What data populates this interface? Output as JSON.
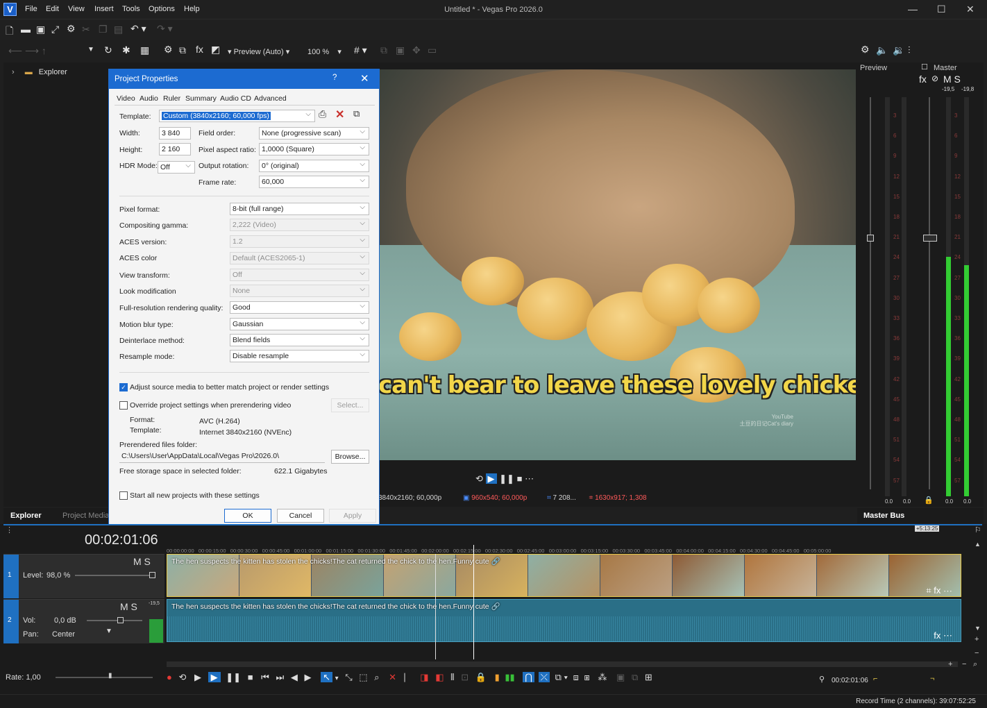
{
  "app": {
    "logo": "V",
    "window_title": "Untitled * - Vegas Pro 2026.0",
    "menu": [
      "File",
      "Edit",
      "View",
      "Insert",
      "Tools",
      "Options",
      "Help"
    ]
  },
  "toolbar2": {
    "preview_quality": "Preview (Auto)",
    "zoom": "100 %"
  },
  "explorer": {
    "tree_item": "Explorer",
    "tabs": [
      "Explorer",
      "Project Media"
    ]
  },
  "preview": {
    "subtitle": "can't bear to leave these lovely chickens.",
    "watermark_line1": "YouTube",
    "watermark_line2": "土豆的日记Cat's diary",
    "status_project": "3840x2160; 60,000p",
    "status_preview": "960x540; 60,000p",
    "status_frame": "7 208...",
    "status_display": "1630x917; 1,308"
  },
  "master": {
    "preview_label": "Preview",
    "master_label": "Master",
    "ms_label": "M S",
    "peak_left": "-19,5",
    "peak_right": "-19,8",
    "scale": [
      "3",
      "6",
      "9",
      "12",
      "15",
      "18",
      "21",
      "24",
      "27",
      "30",
      "33",
      "36",
      "39",
      "42",
      "45",
      "48",
      "51",
      "54",
      "57"
    ],
    "bottom_left": "0.0",
    "bottom_right": "0.0",
    "tab": "Master Bus",
    "meter_levels": [
      0.0,
      0.0,
      0.6,
      0.58
    ]
  },
  "dialog": {
    "title": "Project Properties",
    "help": "?",
    "tabs": [
      "Video",
      "Audio",
      "Ruler",
      "Summary",
      "Audio CD",
      "Advanced"
    ],
    "template_label": "Template:",
    "template_value": "Custom (3840x2160; 60,000 fps)",
    "width_label": "Width:",
    "width_value": "3 840",
    "height_label": "Height:",
    "height_value": "2 160",
    "hdr_label": "HDR Mode:",
    "hdr_value": "Off",
    "field_order_label": "Field order:",
    "field_order_value": "None (progressive scan)",
    "par_label": "Pixel aspect ratio:",
    "par_value": "1,0000 (Square)",
    "rotation_label": "Output rotation:",
    "rotation_value": "0° (original)",
    "framerate_label": "Frame rate:",
    "framerate_value": "60,000",
    "settings": [
      {
        "label": "Pixel format:",
        "value": "8-bit (full range)",
        "disabled": false
      },
      {
        "label": "Compositing gamma:",
        "value": "2,222 (Video)",
        "disabled": true
      },
      {
        "label": "ACES version:",
        "value": "1.2",
        "disabled": true
      },
      {
        "label": "ACES color",
        "value": "Default (ACES2065-1)",
        "disabled": true
      },
      {
        "label": "View transform:",
        "value": "Off",
        "disabled": true
      },
      {
        "label": "Look modification",
        "value": "None",
        "disabled": true
      },
      {
        "label": "Full-resolution rendering quality:",
        "value": "Good",
        "disabled": false
      },
      {
        "label": "Motion blur type:",
        "value": "Gaussian",
        "disabled": false
      },
      {
        "label": "Deinterlace method:",
        "value": "Blend fields",
        "disabled": false
      },
      {
        "label": "Resample mode:",
        "value": "Disable resample",
        "disabled": false
      }
    ],
    "adjust_label": "Adjust source media to better match project or render settings",
    "override_label": "Override project settings when prerendering video",
    "select_button": "Select...",
    "format_label": "Format:",
    "format_value": "AVC (H.264)",
    "pr_template_label": "Template:",
    "pr_template_value": "Internet 3840x2160 (NVEnc)",
    "folder_label": "Prerendered files folder:",
    "folder_value": "C:\\Users\\User\\AppData\\Local\\Vegas Pro\\2026.0\\",
    "browse_button": "Browse...",
    "storage_label": "Free storage space in selected folder:",
    "storage_value": "622.1 Gigabytes",
    "start_all_label": "Start all new projects with these settings",
    "ok": "OK",
    "cancel": "Cancel",
    "apply": "Apply"
  },
  "timeline": {
    "timecode": "00:02:01:06",
    "marker": "+5:13:25",
    "ruler": [
      "00:00:00:00",
      "00:00:15:00",
      "00:00:30:00",
      "00:00:45:00",
      "00:01:00:00",
      "00:01:15:00",
      "00:01:30:00",
      "00:01:45:00",
      "00:02:00:00",
      "00:02:15:00",
      "00:02:30:00",
      "00:02:45:00",
      "00:03:00:00",
      "00:03:15:00",
      "00:03:30:00",
      "00:03:45:00",
      "00:04:00:00",
      "00:04:15:00",
      "00:04:30:00",
      "00:04:45:00",
      "00:05:00:00"
    ],
    "video_track": {
      "number": "1",
      "ms": "M S",
      "level_label": "Level:",
      "level_value": "98,0 %"
    },
    "audio_track": {
      "number": "2",
      "ms": "M S",
      "peak": "-19,5",
      "vol_label": "Vol:",
      "vol_value": "0,0 dB",
      "pan_label": "Pan:",
      "pan_value": "Center"
    },
    "clip_title_a": "The hen suspects the kitten has stolen the chicks!The cat returned the chick to the",
    "clip_title_b": "hen.Funny cute",
    "rate_label": "Rate: 1,00",
    "end_timecode": "00:02:01:06",
    "record_time": "Record Time (2 channels): 39:07:52:25"
  }
}
